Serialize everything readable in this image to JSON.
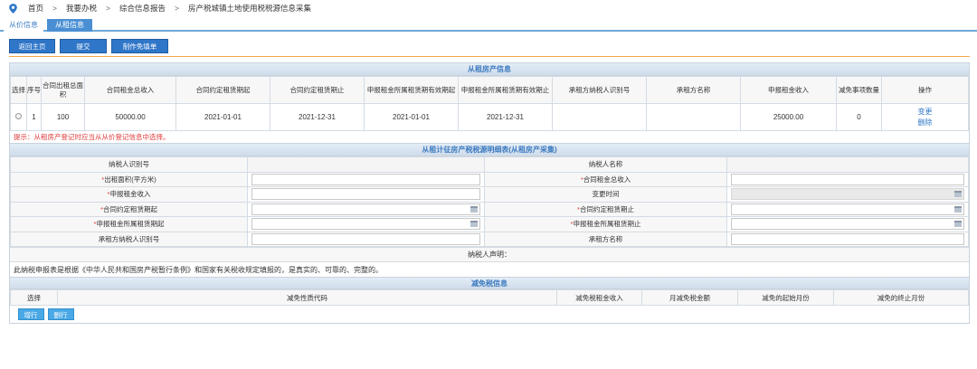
{
  "breadcrumb": {
    "items": [
      "首页",
      "我要办税",
      "综合信息报告",
      "房产税城镇土地使用税税源信息采集"
    ],
    "separator": ">"
  },
  "tabs": [
    {
      "label": "从价信息",
      "active": false
    },
    {
      "label": "从租信息",
      "active": true
    }
  ],
  "toolbar": {
    "back_label": "返回主页",
    "submit_label": "提交",
    "exemption_label": "制作免填单"
  },
  "rent_info": {
    "title": "从租房产信息",
    "columns": [
      "选择",
      "序号",
      "合同出租总面积",
      "合同租金总收入",
      "合同约定租赁期起",
      "合同约定租赁期止",
      "申报租金所属租赁期有效期起",
      "申报租金所属租赁期有效期止",
      "承租方纳税人识别号",
      "承租方名称",
      "申报租金收入",
      "减免事项数量",
      "操作"
    ],
    "rows": [
      {
        "seq": "1",
        "area": "100",
        "total_income": "50000.00",
        "contract_start": "2021-01-01",
        "contract_end": "2021-12-31",
        "decl_start": "2021-01-01",
        "decl_end": "2021-12-31",
        "tenant_id": "",
        "tenant_name": "",
        "declared_income": "25000.00",
        "exempt_count": "0",
        "action_edit": "变更",
        "action_delete": "删除"
      }
    ],
    "tip": "提示：从租房产登记时应当从从价登记信息中选择。"
  },
  "detail": {
    "title": "从租计征房产税税源明细表(从租房产采集)",
    "labels": {
      "taxpayer_id": "纳税人识别号",
      "taxpayer_name": "纳税人名称",
      "lease_area": "出租面积(平方米)",
      "contract_total": "合同租金总收入",
      "declared_income": "申报租金收入",
      "change_time": "变更时间",
      "contract_start": "合同约定租赁期起",
      "contract_end": "合同约定租赁期止",
      "decl_start": "申报租金所属租赁期起",
      "decl_end": "申报租金所属租赁期止",
      "tenant_id": "承租方纳税人识别号",
      "tenant_name": "承租方名称"
    },
    "required_mark": "*",
    "declaration_title": "纳税人声明：",
    "declaration_text": "此纳税申报表是根据《中华人民共和国房产税暂行条例》和国家有关税收规定填报的，是真实的、可靠的、完整的。"
  },
  "exemption": {
    "title": "减免税信息",
    "columns": [
      "选择",
      "减免性质代码",
      "减免税租金收入",
      "月减免税金额",
      "减免的起始月份",
      "减免的终止月份"
    ],
    "add_label": "增行",
    "delete_label": "删行"
  },
  "colors": {
    "primary": "#2f76c8",
    "tab_active": "#4a8fd4",
    "accent_line": "#f2a84a",
    "tip_red": "#e03a3a",
    "small_button": "#4aa8e6"
  }
}
